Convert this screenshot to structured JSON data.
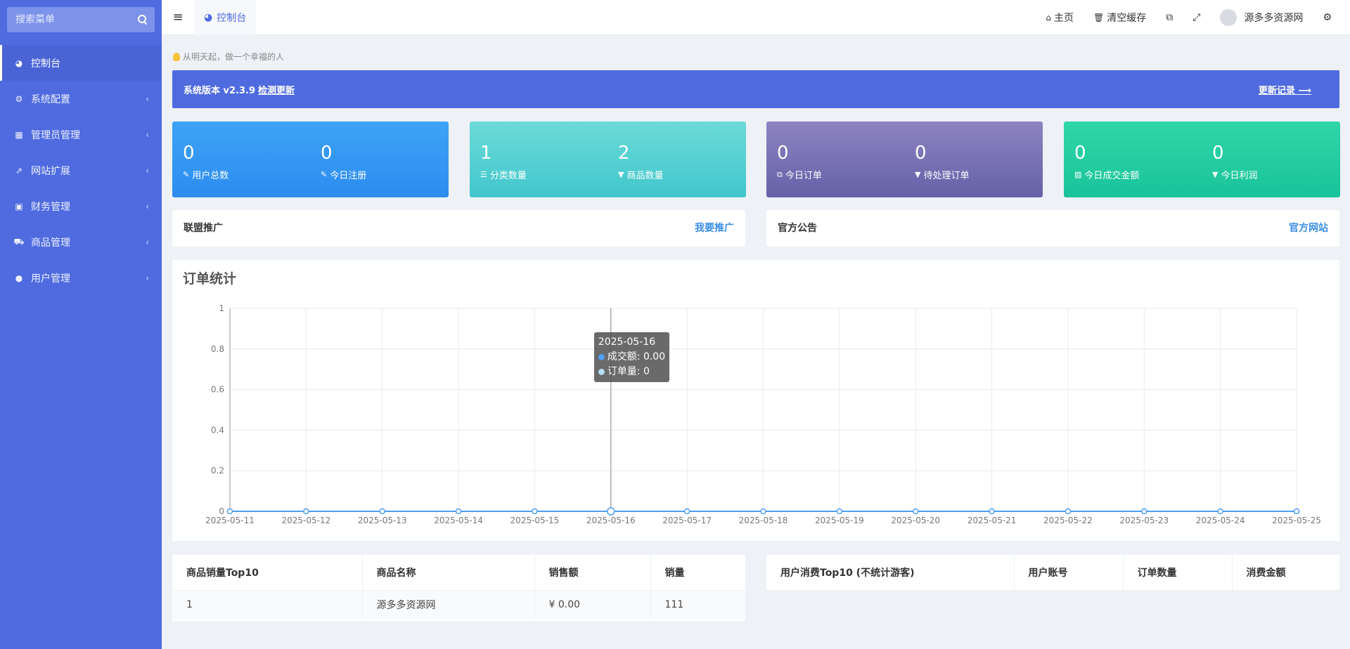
{
  "sidebar": {
    "search_placeholder": "搜索菜单",
    "items": [
      {
        "label": "控制台",
        "icon": "dashboard-icon",
        "glyph": "◕",
        "active": true
      },
      {
        "label": "系统配置",
        "icon": "cogs-icon",
        "glyph": "⚙"
      },
      {
        "label": "管理员管理",
        "icon": "windows-icon",
        "glyph": "▦"
      },
      {
        "label": "网站扩展",
        "icon": "external-link-icon",
        "glyph": "⇗"
      },
      {
        "label": "财务管理",
        "icon": "finance-icon",
        "glyph": "▣"
      },
      {
        "label": "商品管理",
        "icon": "cart-icon",
        "glyph": "⛟"
      },
      {
        "label": "用户管理",
        "icon": "user-icon",
        "glyph": "●"
      }
    ]
  },
  "topbar": {
    "tab_label": "控制台",
    "home_label": "主页",
    "clear_cache_label": "清空缓存",
    "username": "源多多资源网"
  },
  "motto": "从明天起，做一个幸福的人",
  "version_bar": {
    "text": "系统版本 v2.3.9",
    "check_label": "检测更新",
    "changelog_label": "更新记录 ⟶"
  },
  "stats": [
    {
      "a_value": "0",
      "a_label": "用户总数",
      "b_value": "0",
      "b_label": "今日注册"
    },
    {
      "a_value": "1",
      "a_label": "分类数量",
      "b_value": "2",
      "b_label": "商品数量"
    },
    {
      "a_value": "0",
      "a_label": "今日订单",
      "b_value": "0",
      "b_label": "待处理订单"
    },
    {
      "a_value": "0",
      "a_label": "今日成交金额",
      "b_value": "0",
      "b_label": "今日利润"
    }
  ],
  "panels": {
    "promo_title": "联盟推广",
    "promo_link": "我要推广",
    "notice_title": "官方公告",
    "notice_link": "官方网站"
  },
  "chart_title": "订单统计",
  "chart_data": {
    "type": "line",
    "x": [
      "2025-05-11",
      "2025-05-12",
      "2025-05-13",
      "2025-05-14",
      "2025-05-15",
      "2025-05-16",
      "2025-05-17",
      "2025-05-18",
      "2025-05-19",
      "2025-05-20",
      "2025-05-21",
      "2025-05-22",
      "2025-05-23",
      "2025-05-24",
      "2025-05-25"
    ],
    "series": [
      {
        "name": "成交额",
        "color": "#4f9ff2",
        "values": [
          0,
          0,
          0,
          0,
          0,
          0,
          0,
          0,
          0,
          0,
          0,
          0,
          0,
          0,
          0
        ]
      },
      {
        "name": "订单量",
        "color": "#b7dff3",
        "values": [
          0,
          0,
          0,
          0,
          0,
          0,
          0,
          0,
          0,
          0,
          0,
          0,
          0,
          0,
          0
        ]
      }
    ],
    "ylim": [
      0,
      1
    ],
    "yticks": [
      "0",
      "0.2",
      "0.4",
      "0.6",
      "0.8",
      "1"
    ],
    "grid": true,
    "tooltip": {
      "date": "2025-05-16",
      "line1": "成交额: 0.00",
      "line2": "订单量: 0"
    }
  },
  "top_products": {
    "headers": [
      "商品销量Top10",
      "商品名称",
      "销售额",
      "销量"
    ],
    "rows": [
      [
        "1",
        "源多多资源网",
        "¥ 0.00",
        "111"
      ]
    ]
  },
  "top_users": {
    "headers": [
      "用户消费Top10 (不统计游客)",
      "用户账号",
      "订单数量",
      "消费金额"
    ]
  }
}
